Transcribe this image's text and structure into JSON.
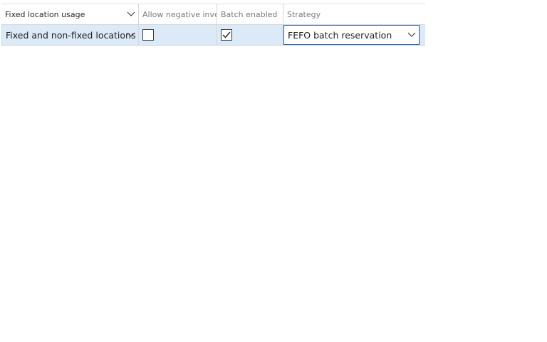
{
  "grid": {
    "columns": [
      {
        "label": "Fixed location usage",
        "has_dropdown": true
      },
      {
        "label": "Allow negative inve...",
        "has_dropdown": false
      },
      {
        "label": "Batch enabled",
        "has_dropdown": false
      },
      {
        "label": "Strategy",
        "has_dropdown": false
      }
    ],
    "row": {
      "fixed_location_usage": "Fixed and non-fixed locations",
      "allow_negative_inventory": false,
      "batch_enabled": true,
      "strategy": "FEFO batch reservation"
    }
  },
  "colors": {
    "row_highlight": "#dce9f7",
    "focus_border": "#2e63a8"
  },
  "icons": {
    "header_dropdown": "chevron-down-icon",
    "cell_dropdown": "chevron-down-icon",
    "checkmark": "checkmark-icon"
  }
}
